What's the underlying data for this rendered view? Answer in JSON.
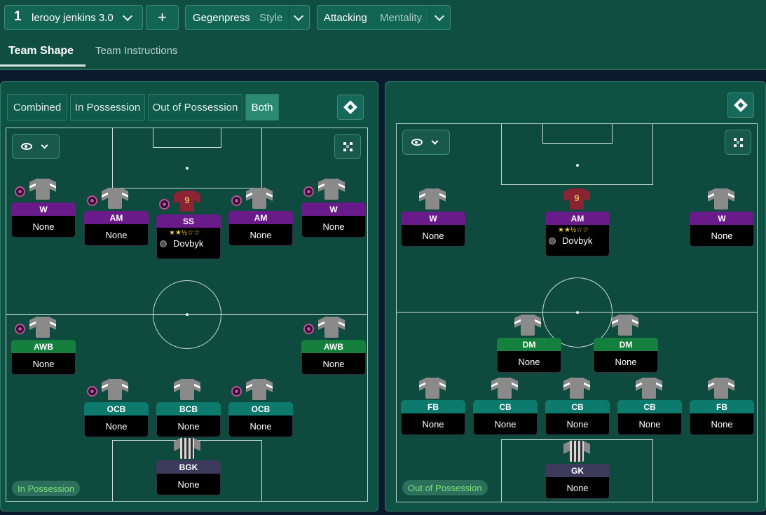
{
  "topbar": {
    "tactic_number": "1",
    "tactic_name": "lerooy jenkins 3.0",
    "add_label": "+",
    "style_value": "Gegenpress",
    "style_label": "Style",
    "mentality_value": "Attacking",
    "mentality_label": "Mentality"
  },
  "tabs": [
    "Team Shape",
    "Team Instructions"
  ],
  "view_modes": [
    "Combined",
    "In Possession",
    "Out of Possession",
    "Both"
  ],
  "active_view_mode": "Both",
  "colors": {
    "attacker_role": "#6a1b8a",
    "midfield_role": "#15803d",
    "defender_role": "#0d7a6e",
    "keeper_role": "#3e3a5c",
    "badge_text": "#7ee07a"
  },
  "in_possession": {
    "badge": "In Possession",
    "players": [
      {
        "role": "W",
        "name": "None"
      },
      {
        "role": "AM",
        "name": "None"
      },
      {
        "role": "SS",
        "name": "Dovbyk",
        "shirt_number": "9",
        "stars": "★★½☆☆"
      },
      {
        "role": "AM",
        "name": "None"
      },
      {
        "role": "W",
        "name": "None"
      },
      {
        "role": "AWB",
        "name": "None"
      },
      {
        "role": "AWB",
        "name": "None"
      },
      {
        "role": "OCB",
        "name": "None"
      },
      {
        "role": "BCB",
        "name": "None"
      },
      {
        "role": "OCB",
        "name": "None"
      },
      {
        "role": "BGK",
        "name": "None"
      }
    ]
  },
  "out_of_possession": {
    "badge": "Out of Possession",
    "players": [
      {
        "role": "W",
        "name": "None"
      },
      {
        "role": "AM",
        "name": "Dovbyk",
        "shirt_number": "9",
        "stars": "★★½☆☆"
      },
      {
        "role": "W",
        "name": "None"
      },
      {
        "role": "DM",
        "name": "None"
      },
      {
        "role": "DM",
        "name": "None"
      },
      {
        "role": "FB",
        "name": "None"
      },
      {
        "role": "CB",
        "name": "None"
      },
      {
        "role": "CB",
        "name": "None"
      },
      {
        "role": "CB",
        "name": "None"
      },
      {
        "role": "FB",
        "name": "None"
      },
      {
        "role": "GK",
        "name": "None"
      }
    ]
  }
}
